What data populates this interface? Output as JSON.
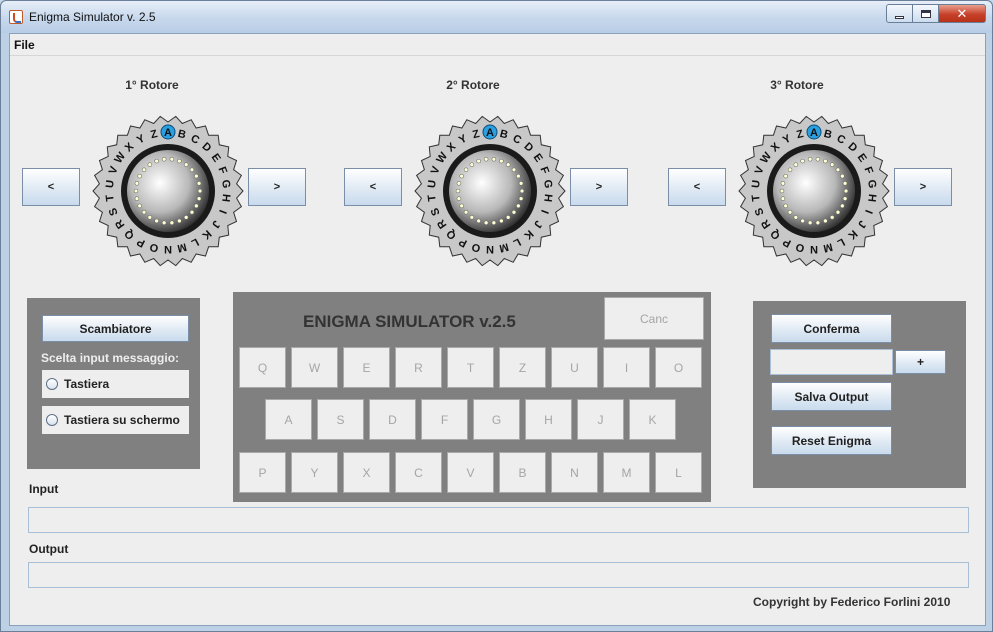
{
  "window": {
    "title": "Enigma Simulator v. 2.5",
    "icon": "java-cup-icon"
  },
  "menu": {
    "file": "File"
  },
  "rotors": [
    {
      "title": "1° Rotore",
      "left_button": "<",
      "right_button": ">",
      "current": "A"
    },
    {
      "title": "2° Rotore",
      "left_button": "<",
      "right_button": ">",
      "current": "A"
    },
    {
      "title": "3° Rotore",
      "left_button": "<",
      "right_button": ">",
      "current": "A"
    }
  ],
  "rotor_alphabet": [
    "A",
    "B",
    "C",
    "D",
    "E",
    "F",
    "G",
    "H",
    "I",
    "J",
    "K",
    "L",
    "M",
    "N",
    "O",
    "P",
    "Q",
    "R",
    "S",
    "T",
    "U",
    "V",
    "W",
    "X",
    "Y",
    "Z"
  ],
  "left_panel": {
    "scambiatore": "Scambiatore",
    "scelta_label": "Scelta input messaggio:",
    "options": [
      "Tastiera",
      "Tastiera su schermo"
    ]
  },
  "keyboard": {
    "title": "ENIGMA SIMULATOR v.2.5",
    "canc": "Canc",
    "rows": [
      [
        "Q",
        "W",
        "E",
        "R",
        "T",
        "Z",
        "U",
        "I",
        "O"
      ],
      [
        "A",
        "S",
        "D",
        "F",
        "G",
        "H",
        "J",
        "K"
      ],
      [
        "P",
        "Y",
        "X",
        "C",
        "V",
        "B",
        "N",
        "M",
        "L"
      ]
    ]
  },
  "right_panel": {
    "conferma": "Conferma",
    "plus": "+",
    "plug_value": "",
    "salva": "Salva Output",
    "reset": "Reset Enigma"
  },
  "io": {
    "input_label": "Input",
    "input_value": "",
    "output_label": "Output",
    "output_value": ""
  },
  "footer": {
    "copyright": "Copyright by Federico Forlini 2010"
  },
  "colors": {
    "panel_gray": "#808080",
    "highlight_letter": "#2aa0e0",
    "window_frame": "#bcd0e6"
  }
}
